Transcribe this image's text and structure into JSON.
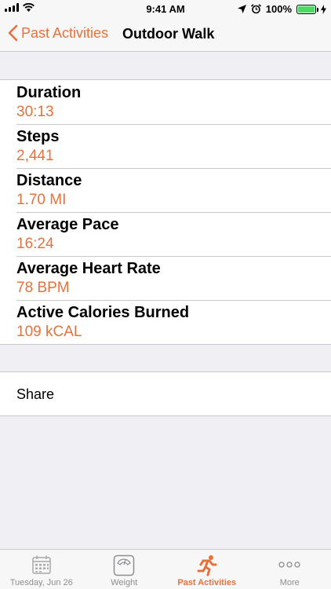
{
  "status_bar": {
    "time": "9:41 AM",
    "battery_percent": "100%",
    "battery_level": 1.0
  },
  "nav": {
    "back_label": "Past Activities",
    "title": "Outdoor Walk"
  },
  "stats": [
    {
      "label": "Duration",
      "value": "30:13"
    },
    {
      "label": "Steps",
      "value": "2,441"
    },
    {
      "label": "Distance",
      "value": "1.70 MI"
    },
    {
      "label": "Average Pace",
      "value": "16:24"
    },
    {
      "label": "Average Heart Rate",
      "value": "78 BPM"
    },
    {
      "label": "Active Calories Burned",
      "value": "109 kCAL"
    }
  ],
  "share": {
    "label": "Share"
  },
  "tabs": [
    {
      "label": "Tuesday, Jun 26",
      "icon": "calendar-icon",
      "active": false
    },
    {
      "label": "Weight",
      "icon": "scale-icon",
      "active": false
    },
    {
      "label": "Past Activities",
      "icon": "runner-icon",
      "active": true
    },
    {
      "label": "More",
      "icon": "more-icon",
      "active": false
    }
  ],
  "colors": {
    "accent": "#e8713a",
    "background": "#efeff4",
    "bar": "#f7f7f7",
    "battery": "#4cd964"
  }
}
